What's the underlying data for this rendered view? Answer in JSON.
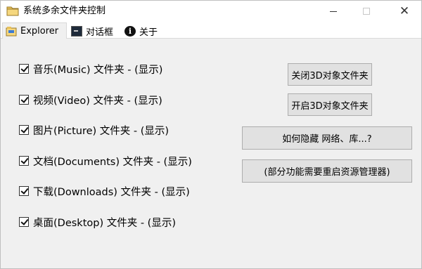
{
  "window": {
    "title": "系统多余文件夹控制",
    "close_glyph": "✕"
  },
  "tabs": [
    {
      "label": "Explorer"
    },
    {
      "label": "对话框"
    },
    {
      "label": "关于",
      "icon_glyph": "i"
    }
  ],
  "checkboxes": [
    {
      "label": "音乐(Music) 文件夹 - (显示)",
      "checked": true
    },
    {
      "label": "视频(Video) 文件夹 - (显示)",
      "checked": true
    },
    {
      "label": "图片(Picture) 文件夹 - (显示)",
      "checked": true
    },
    {
      "label": "文档(Documents) 文件夹 - (显示)",
      "checked": true
    },
    {
      "label": "下载(Downloads) 文件夹 - (显示)",
      "checked": true
    },
    {
      "label": "桌面(Desktop) 文件夹 - (显示)",
      "checked": true
    }
  ],
  "buttons": {
    "close_3d": "关闭3D对象文件夹",
    "open_3d": "开启3D对象文件夹",
    "how_hide": "如何隐藏 网络、库...?",
    "restart_note": "(部分功能需要重启资源管理器)"
  },
  "colors": {
    "background": "#f0f0f0",
    "button": "#e1e1e1",
    "button_border": "#adadad",
    "folder_icon": "#e8c15a"
  }
}
